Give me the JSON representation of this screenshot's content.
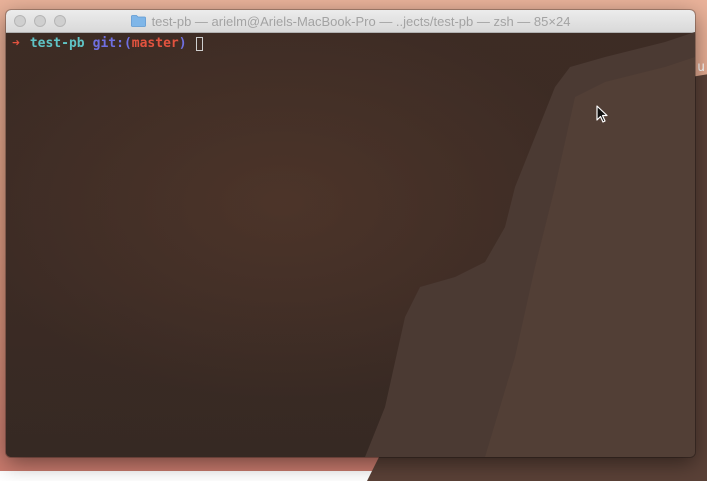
{
  "window": {
    "title": "test-pb — arielm@Ariels-MacBook-Pro — ..jects/test-pb — zsh — 85×24"
  },
  "terminal": {
    "prompt_arrow": "➜",
    "directory": "test-pb",
    "git_label": "git:",
    "paren_open": "(",
    "branch": "master",
    "paren_close": ")"
  },
  "desktop": {
    "edge_char": "u"
  },
  "colors": {
    "terminal_bg": "#3f2e27",
    "prompt_arrow": "#e2533f",
    "directory": "#5fc4c6",
    "git_label": "#6f6fe0",
    "branch": "#e2533f"
  },
  "icons": [
    "folder-icon",
    "mouse-pointer-icon"
  ]
}
